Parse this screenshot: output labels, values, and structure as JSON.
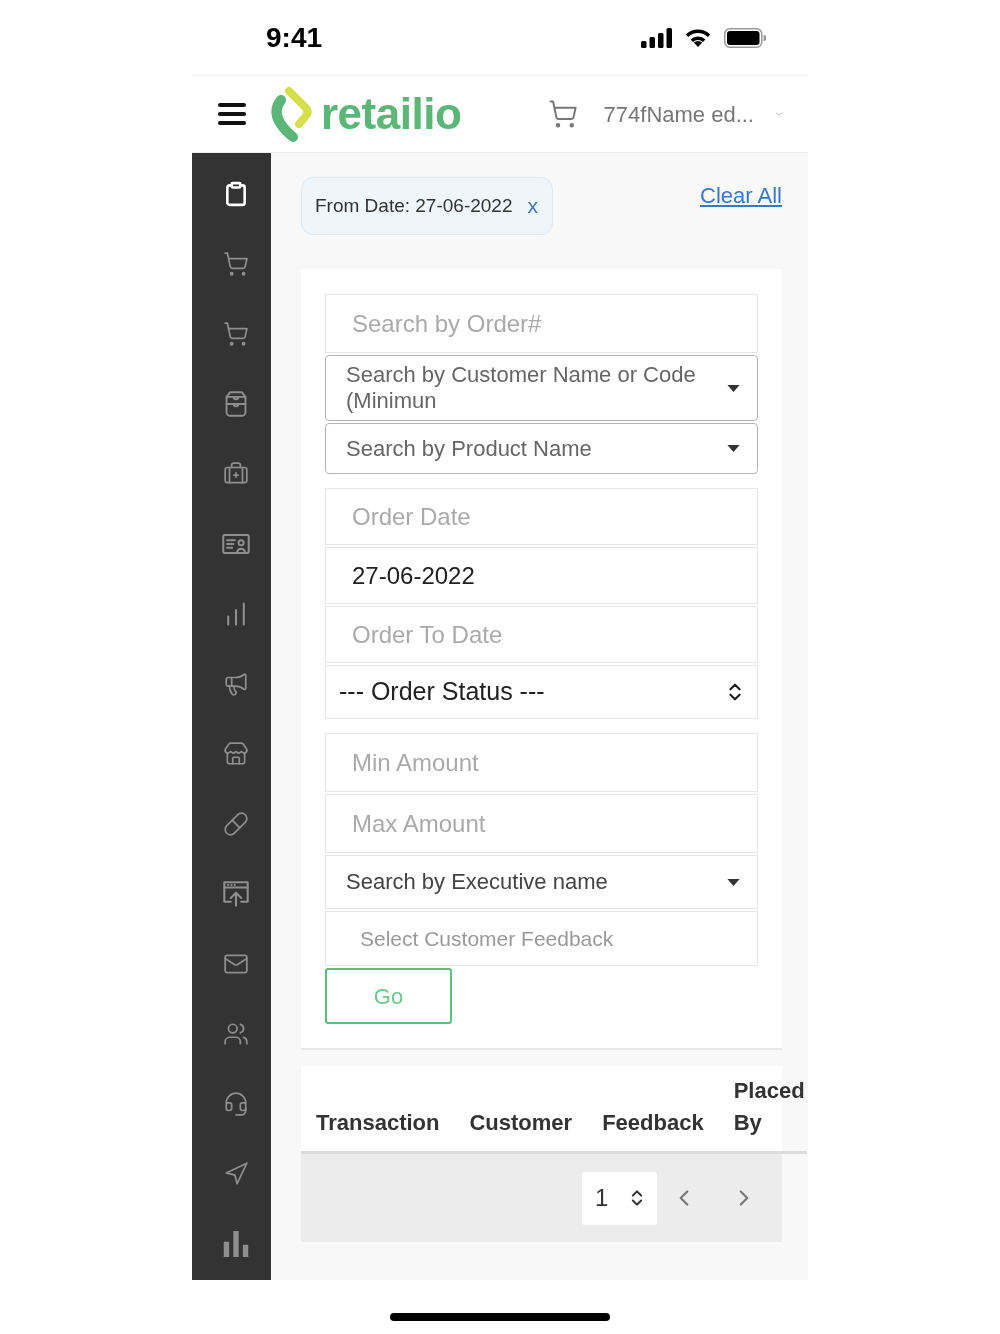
{
  "status_bar": {
    "time": "9:41"
  },
  "header": {
    "brand": "retailio",
    "account": "774fName ed..."
  },
  "sidebar": {
    "items": [
      {
        "selected": true
      },
      {
        "selected": false
      },
      {
        "selected": false
      },
      {
        "selected": false
      },
      {
        "selected": false
      },
      {
        "selected": false
      },
      {
        "selected": false
      },
      {
        "selected": false
      },
      {
        "selected": false
      },
      {
        "selected": false
      },
      {
        "selected": false
      },
      {
        "selected": false
      },
      {
        "selected": false
      },
      {
        "selected": false
      },
      {
        "selected": false
      },
      {
        "selected": false
      }
    ]
  },
  "filter_chips": [
    {
      "label": "From Date: 27-06-2022",
      "remove": "x"
    }
  ],
  "clear_all": "Clear All",
  "filter_groups": [
    {
      "fields": [
        {
          "kind": "input",
          "placeholder": "Search by Order#"
        },
        {
          "kind": "dropdown",
          "placeholder": "Search by Customer Name or Code (Minimun"
        },
        {
          "kind": "dropdown",
          "placeholder": "Search by Product Name"
        }
      ]
    },
    {
      "fields": [
        {
          "kind": "date",
          "placeholder": "Order Date"
        },
        {
          "kind": "date",
          "value": "27-06-2022"
        },
        {
          "kind": "date",
          "placeholder": "Order To Date"
        },
        {
          "kind": "select",
          "value": "--- Order Status ---"
        }
      ]
    },
    {
      "fields": [
        {
          "kind": "input",
          "placeholder": "Min Amount"
        },
        {
          "kind": "input",
          "placeholder": "Max Amount"
        },
        {
          "kind": "combo",
          "placeholder": "Search by Executive name"
        },
        {
          "kind": "picker",
          "placeholder": "Select Customer Feedback"
        }
      ]
    }
  ],
  "go_button": "Go",
  "table": {
    "columns": [
      "Transaction",
      "Customer",
      "Feedback",
      "Placed By"
    ]
  },
  "pagination": {
    "page_size": "1"
  }
}
